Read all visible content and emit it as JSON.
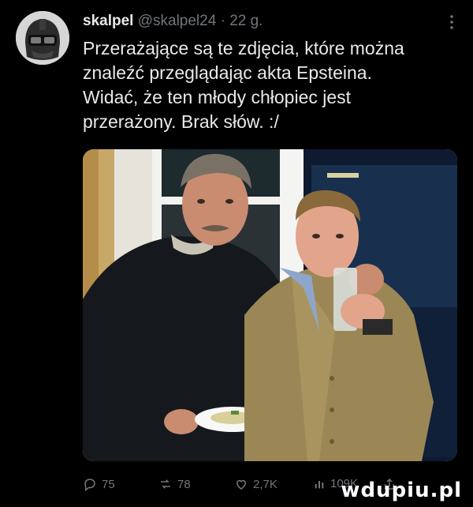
{
  "tweet": {
    "author_name": "skalpel",
    "handle": "@skalpel24",
    "separator": "·",
    "time": "22 g.",
    "text_lines": [
      "Przerażające są te zdjęcia, które można",
      "znaleźć przeglądając akta Epsteina.",
      "Widać, że ten młody chłopiec jest",
      "przerażony. Brak słów. :/"
    ]
  },
  "actions": {
    "replies": "75",
    "reposts": "78",
    "likes": "2,7K",
    "views": "109K"
  },
  "watermark": "wdupiu.pl",
  "colors": {
    "background": "#000000",
    "text": "#e7e9ea",
    "muted": "#71767b"
  },
  "icons": [
    "avatar-helmet-icon",
    "more-icon",
    "reply-icon",
    "repost-icon",
    "like-icon",
    "views-icon",
    "share-icon"
  ]
}
